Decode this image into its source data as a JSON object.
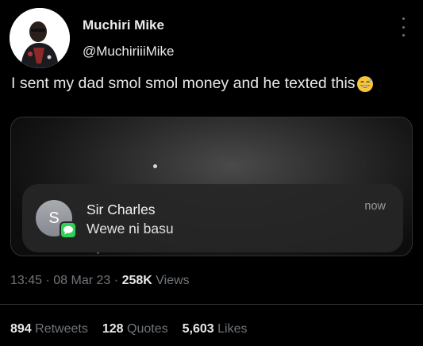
{
  "author": {
    "name": "Muchiri Mike",
    "handle": "@MuchiriiiMike"
  },
  "tweet": {
    "text": "I sent my dad smol smol money and he texted this",
    "emoji": "grinning-sweat-emoji"
  },
  "notification": {
    "contact_initial": "S",
    "contact_name": "Sir Charles",
    "message": "Wewe ni basu",
    "time": "now",
    "app_icon": "messages-icon"
  },
  "meta": {
    "time": "13:45",
    "separator": "·",
    "date": "08 Mar 23",
    "views_count": "258K",
    "views_label": "Views"
  },
  "stats": {
    "retweets_count": "894",
    "retweets_label": "Retweets",
    "quotes_count": "128",
    "quotes_label": "Quotes",
    "likes_count": "5,603",
    "likes_label": "Likes"
  },
  "colors": {
    "background": "#000000",
    "primary_text": "#e7e9ea",
    "secondary_text": "#71767b",
    "messages_green": "#2fd158"
  }
}
